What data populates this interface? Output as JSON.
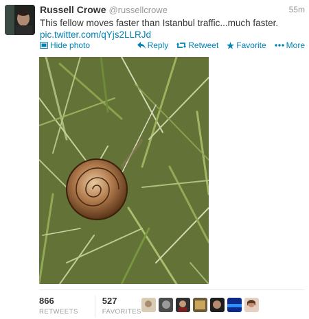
{
  "tweet": {
    "fullname": "Russell Crowe",
    "username": "@russellcrowe",
    "timestamp": "55m",
    "text": "This fellow moves faster than Istanbul traffic...much faster.",
    "link": "pic.twitter.com/qYjs2LLRJd"
  },
  "actions": {
    "hide_photo": "Hide photo",
    "reply": "Reply",
    "retweet": "Retweet",
    "favorite": "Favorite",
    "more": "More"
  },
  "stats": {
    "retweets_count": "866",
    "retweets_label": "RETWEETS",
    "favorites_count": "527",
    "favorites_label": "FAVORITES"
  },
  "colors": {
    "link": "#0084b4",
    "muted": "#999999",
    "text": "#333333"
  },
  "icons": [
    "photo-icon",
    "reply-icon",
    "retweet-icon",
    "favorite-icon",
    "more-icon"
  ]
}
